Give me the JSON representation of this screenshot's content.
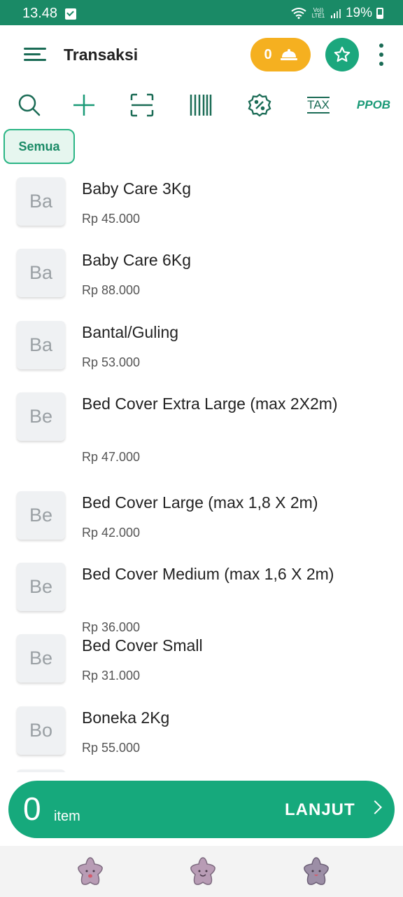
{
  "status_bar": {
    "time": "13.48",
    "network": "Vo)) LTE1",
    "battery": "19%"
  },
  "app_bar": {
    "title": "Transaksi",
    "queue_count": "0",
    "icons": [
      "menu-icon",
      "serving-dish-icon",
      "star-icon",
      "more-vert-icon"
    ]
  },
  "toolbar": {
    "icons": [
      "search-icon",
      "plus-icon",
      "scan-icon",
      "barcode-icon",
      "discount-icon"
    ],
    "tax_label": "TAX",
    "ppob_label": "PPOB"
  },
  "filter": {
    "selected": "Semua"
  },
  "products": [
    {
      "initials": "Ba",
      "name": "Baby Care 3Kg",
      "price": "Rp 45.000"
    },
    {
      "initials": "Ba",
      "name": "Baby Care 6Kg",
      "price": "Rp 88.000"
    },
    {
      "initials": "Ba",
      "name": "Bantal/Guling",
      "price": "Rp 53.000"
    },
    {
      "initials": "Be",
      "name": "Bed Cover Extra Large (max 2X2m)",
      "price": "Rp 47.000"
    },
    {
      "initials": "Be",
      "name": "Bed Cover Large (max 1,8 X 2m)",
      "price": "Rp 42.000"
    },
    {
      "initials": "Be",
      "name": "Bed Cover Medium (max 1,6 X 2m)",
      "price": "Rp 36.000"
    },
    {
      "initials": "Be",
      "name": "Bed Cover Small",
      "price": "Rp 31.000"
    },
    {
      "initials": "Bo",
      "name": "Boneka 2Kg",
      "price": "Rp 55.000"
    }
  ],
  "cart": {
    "count": "0",
    "unit": "item",
    "next_label": "LANJUT"
  },
  "bottom_nav": {
    "icons": [
      "star-face-icon-1",
      "star-face-icon-2",
      "star-face-icon-3"
    ]
  },
  "colors": {
    "primary": "#1a8a66",
    "accent": "#f5b020",
    "cart": "#16a97c"
  }
}
